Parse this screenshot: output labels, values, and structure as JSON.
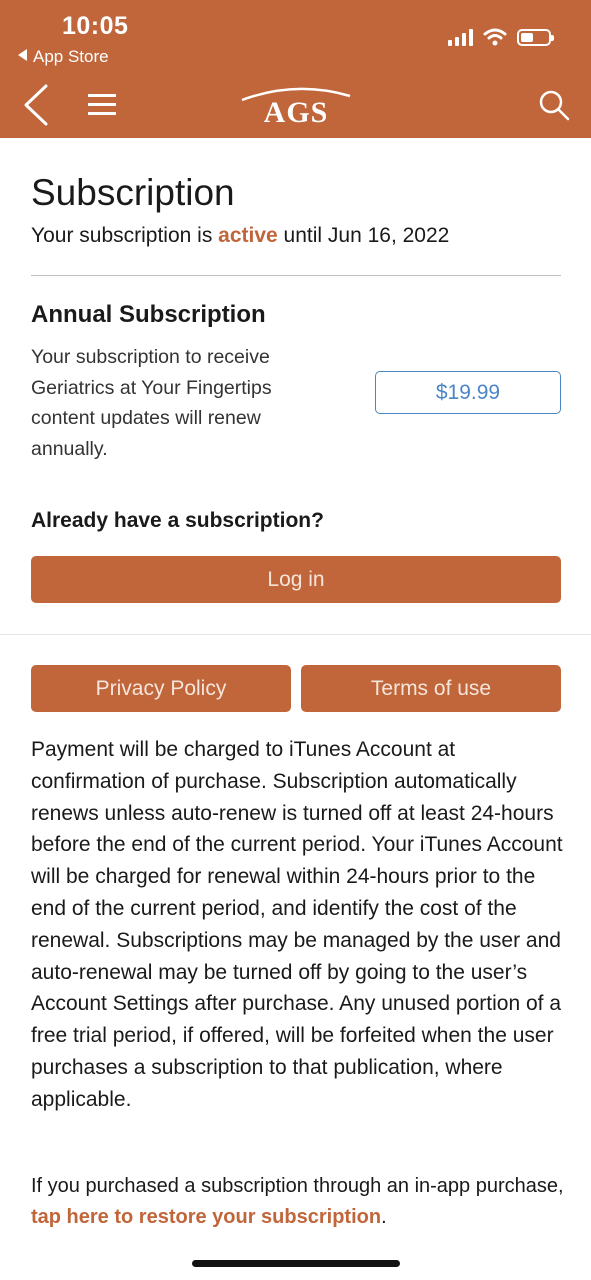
{
  "status_bar": {
    "time": "10:05",
    "back_app": "App Store"
  },
  "nav": {
    "logo_text": "AGS",
    "back_icon": "chevron-left-icon",
    "menu_icon": "hamburger-icon",
    "search_icon": "search-icon"
  },
  "colors": {
    "brand": "#c0663a",
    "link_blue": "#4a86c6"
  },
  "subscription": {
    "title": "Subscription",
    "status_prefix": "Your subscription is ",
    "status_word": "active",
    "status_suffix": " until Jun 16, 2022"
  },
  "annual": {
    "title": "Annual Subscription",
    "description": "Your subscription to receive Geriatrics at Your Fingertips content updates will renew annually.",
    "price": "$19.99"
  },
  "login": {
    "prompt": "Already have a subscription?",
    "button_label": "Log in"
  },
  "links": {
    "privacy_label": "Privacy Policy",
    "terms_label": "Terms of use"
  },
  "legal_text": "Payment will be charged to iTunes Account at confirmation of purchase. Subscription automatically renews unless auto-renew is turned off at least 24-hours before the end of the current period. Your iTunes Account will be charged for renewal within 24-hours prior to the end of the current period, and identify the cost of the renewal. Subscriptions may be managed by the user and auto-renewal may be turned off by going to the user’s Account Settings after purchase. Any unused portion of a free trial period, if offered, will be forfeited when the user purchases a subscription to that publication, where applicable.",
  "restore": {
    "prefix": "If you purchased a subscription through an in-app purchase, ",
    "link_label": "tap here to restore your subscription",
    "suffix": "."
  }
}
